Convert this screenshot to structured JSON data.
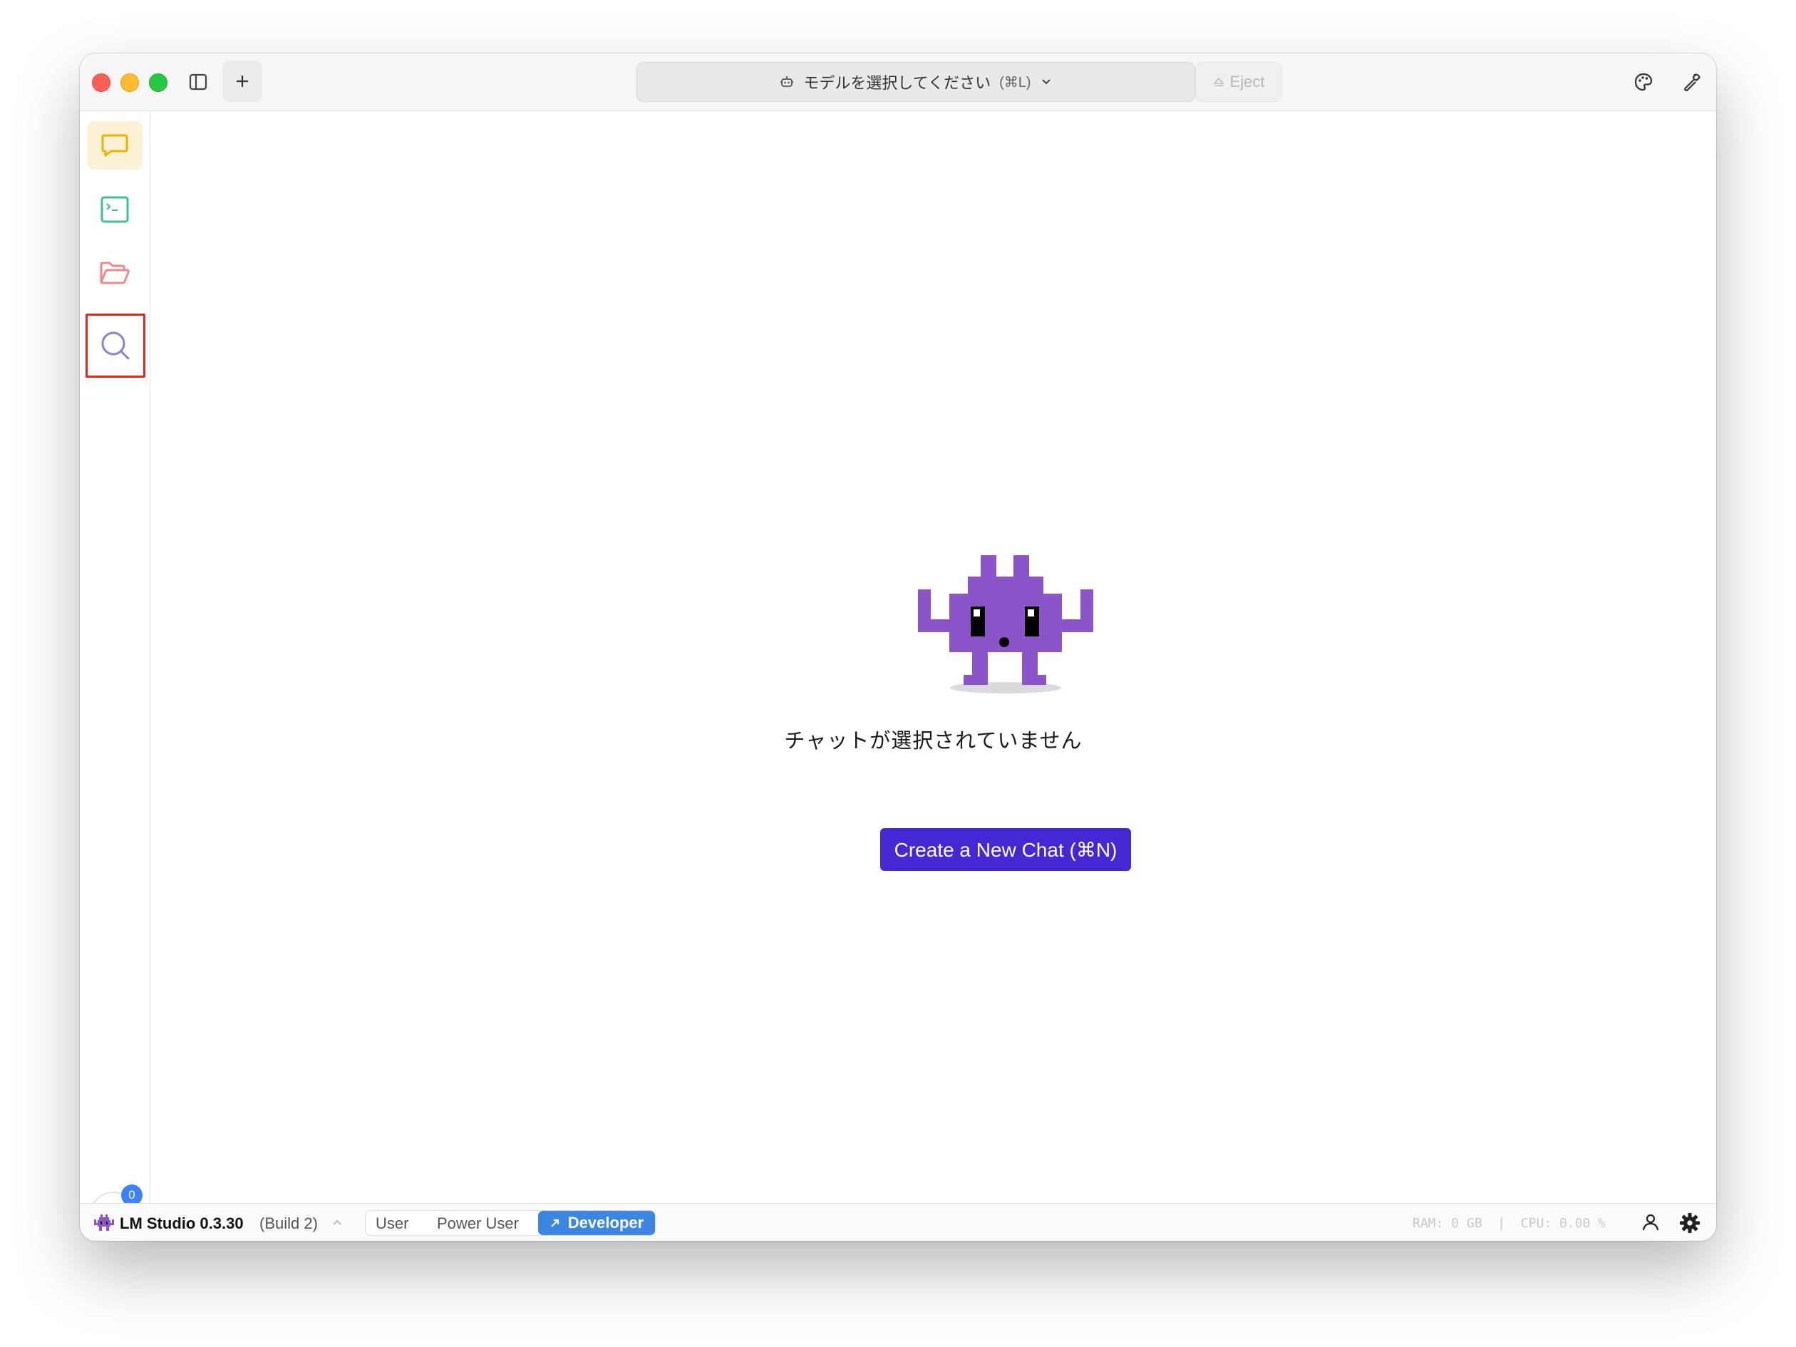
{
  "titlebar": {
    "model_select_label": "モデルを選択してください",
    "model_select_shortcut": "(⌘L)",
    "eject_label": "Eject"
  },
  "sidebar": {
    "items": [
      {
        "name": "chat",
        "icon": "chat-bubble-icon",
        "color": "#e8b400",
        "active": true
      },
      {
        "name": "developer",
        "icon": "terminal-icon",
        "color": "#3fbf96"
      },
      {
        "name": "my-models",
        "icon": "folder-icon",
        "color": "#ee8a8a"
      },
      {
        "name": "discover",
        "icon": "search-icon",
        "color": "#8a7fd6",
        "highlighted": true
      }
    ],
    "downloads_badge": "0"
  },
  "main": {
    "empty_message": "チャットが選択されていません",
    "create_button": "Create a New Chat (⌘N)",
    "mascot_color": "#8b55c9"
  },
  "statusbar": {
    "app_name": "LM Studio 0.3.30",
    "build": "(Build 2)",
    "modes": [
      "User",
      "Power User",
      "Developer"
    ],
    "active_mode": "Developer",
    "ram": "RAM: 0 GB",
    "separator": "|",
    "cpu": "CPU: 0.00 %"
  },
  "colors": {
    "accent": "#4527d4",
    "developer_mode": "#3b86e0",
    "highlight_box": "#e2281b"
  }
}
